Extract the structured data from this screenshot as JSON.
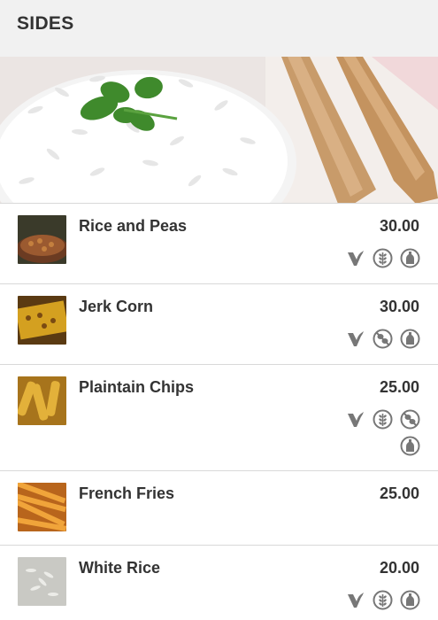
{
  "header": {
    "title": "SIDES"
  },
  "items": [
    {
      "name": "Rice and Peas",
      "price": "30.00",
      "icons": [
        "vegan-v-icon",
        "no-gluten-grain-icon",
        "no-dairy-bottle-icon"
      ]
    },
    {
      "name": "Jerk Corn",
      "price": "30.00",
      "icons": [
        "vegan-v-icon",
        "no-nuts-icon",
        "no-dairy-bottle-icon"
      ]
    },
    {
      "name": "Plaintain Chips",
      "price": "25.00",
      "icons": [
        "vegan-v-icon",
        "no-gluten-grain-icon",
        "no-nuts-icon",
        "no-dairy-bottle-icon"
      ]
    },
    {
      "name": "French Fries",
      "price": "25.00",
      "icons": []
    },
    {
      "name": "White Rice",
      "price": "20.00",
      "icons": [
        "vegan-v-icon",
        "no-gluten-grain-icon",
        "no-dairy-bottle-icon"
      ]
    }
  ],
  "colors": {
    "header_bg": "#f1f1f1",
    "icon": "#777777",
    "divider": "#d9d9d9",
    "text": "#333333"
  }
}
